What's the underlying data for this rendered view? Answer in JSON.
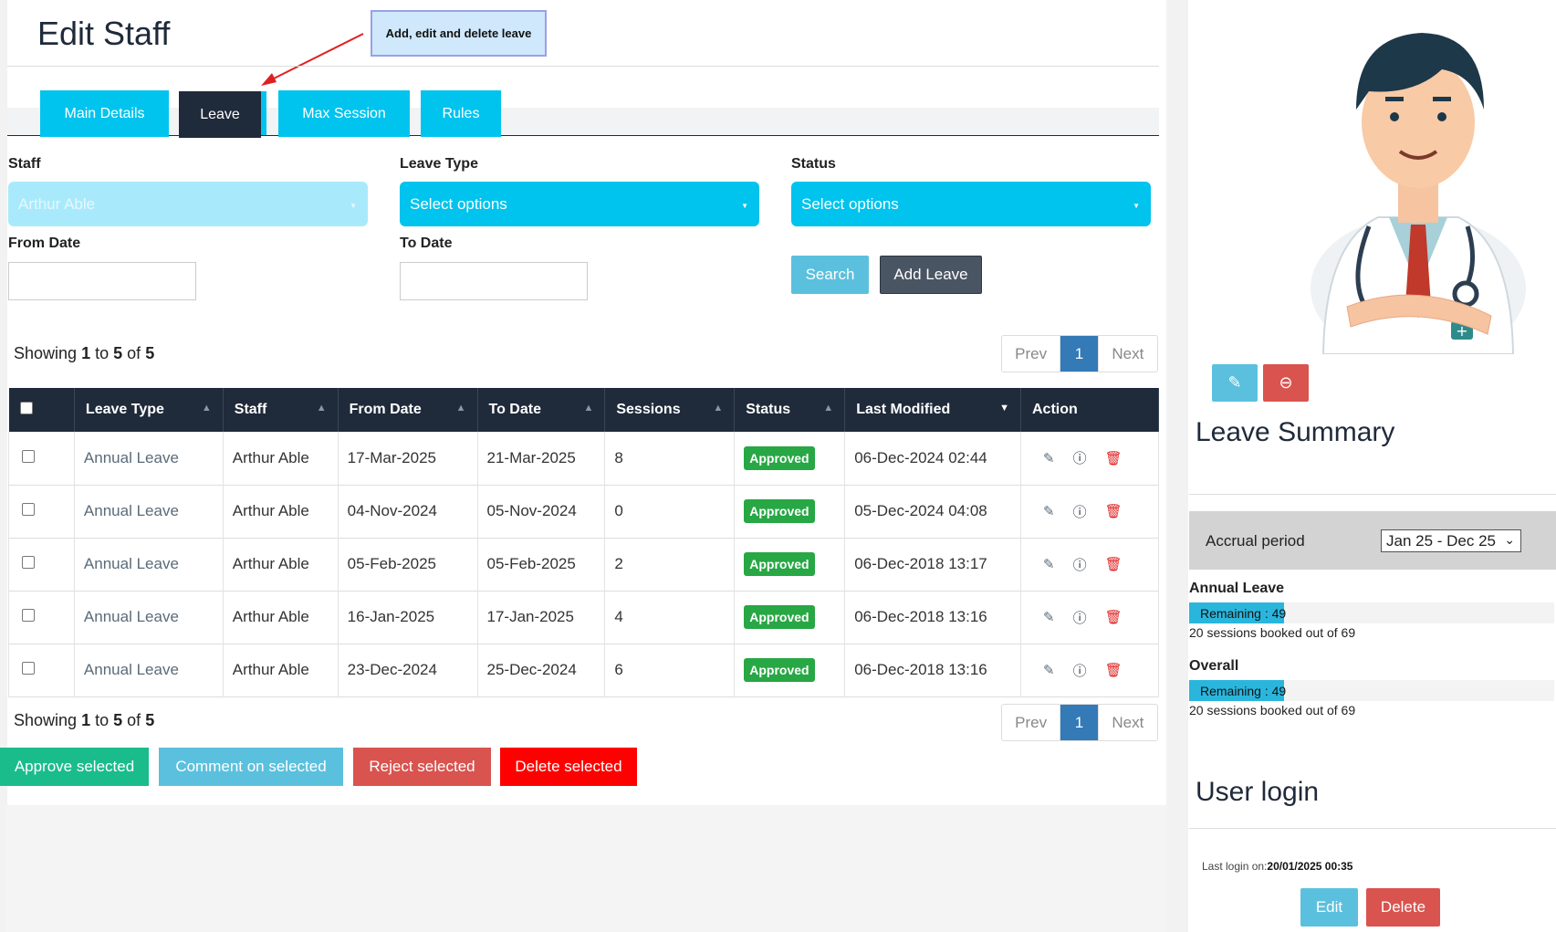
{
  "header": {
    "title": "Edit Staff",
    "callout": "Add, edit and delete leave"
  },
  "tabs": [
    {
      "label": "Main Details"
    },
    {
      "label": "Leave"
    },
    {
      "label": "Max Session"
    },
    {
      "label": "Rules"
    }
  ],
  "filters": {
    "staff_label": "Staff",
    "staff_value": "Arthur Able",
    "leave_type_label": "Leave Type",
    "leave_type_value": "Select options",
    "status_label": "Status",
    "status_value": "Select options",
    "from_date_label": "From Date",
    "to_date_label": "To Date",
    "search_label": "Search",
    "add_leave_label": "Add Leave"
  },
  "showing": {
    "prefix": "Showing",
    "from": "1",
    "to_word": "to",
    "to": "5",
    "of_word": "of",
    "total": "5"
  },
  "pagination": {
    "prev": "Prev",
    "current": "1",
    "next": "Next"
  },
  "table": {
    "columns": [
      "Leave Type",
      "Staff",
      "From Date",
      "To Date",
      "Sessions",
      "Status",
      "Last Modified",
      "Action"
    ],
    "rows": [
      {
        "leave_type": "Annual Leave",
        "staff": "Arthur Able",
        "from": "17-Mar-2025",
        "to": "21-Mar-2025",
        "sessions": "8",
        "status": "Approved",
        "modified": "06-Dec-2024 02:44"
      },
      {
        "leave_type": "Annual Leave",
        "staff": "Arthur Able",
        "from": "04-Nov-2024",
        "to": "05-Nov-2024",
        "sessions": "0",
        "status": "Approved",
        "modified": "05-Dec-2024 04:08"
      },
      {
        "leave_type": "Annual Leave",
        "staff": "Arthur Able",
        "from": "05-Feb-2025",
        "to": "05-Feb-2025",
        "sessions": "2",
        "status": "Approved",
        "modified": "06-Dec-2018 13:17"
      },
      {
        "leave_type": "Annual Leave",
        "staff": "Arthur Able",
        "from": "16-Jan-2025",
        "to": "17-Jan-2025",
        "sessions": "4",
        "status": "Approved",
        "modified": "06-Dec-2018 13:16"
      },
      {
        "leave_type": "Annual Leave",
        "staff": "Arthur Able",
        "from": "23-Dec-2024",
        "to": "25-Dec-2024",
        "sessions": "6",
        "status": "Approved",
        "modified": "06-Dec-2018 13:16"
      }
    ]
  },
  "bulk_actions": {
    "approve": "Approve selected",
    "comment": "Comment on selected",
    "reject": "Reject selected",
    "delete": "Delete selected"
  },
  "leave_summary": {
    "title": "Leave Summary",
    "accrual_label": "Accrual period",
    "accrual_value": "Jan 25 - Dec 25",
    "annual": {
      "title": "Annual Leave",
      "remaining_label": "Remaining : 49",
      "remaining_fraction": 0.26,
      "booked": "20 sessions booked out of 69"
    },
    "overall": {
      "title": "Overall",
      "remaining_label": "Remaining : 49",
      "remaining_fraction": 0.26,
      "booked": "20 sessions booked out of 69"
    }
  },
  "user_login": {
    "title": "User login",
    "last_login_label": "Last login on:",
    "last_login_value": "20/01/2025 00:35",
    "edit_label": "Edit",
    "delete_label": "Delete"
  },
  "colors": {
    "tab": "#00c3ee",
    "tab_active": "#1f2a3a",
    "approve": "#1abc8c",
    "comment": "#5bc0de",
    "reject": "#d9534f",
    "delete": "#ff0000",
    "badge": "#28a745"
  },
  "icons": [
    "edit-icon",
    "info-icon",
    "trash-icon",
    "sort-up-icon",
    "sort-down-icon",
    "caret-down-icon",
    "minus-circle-icon"
  ]
}
